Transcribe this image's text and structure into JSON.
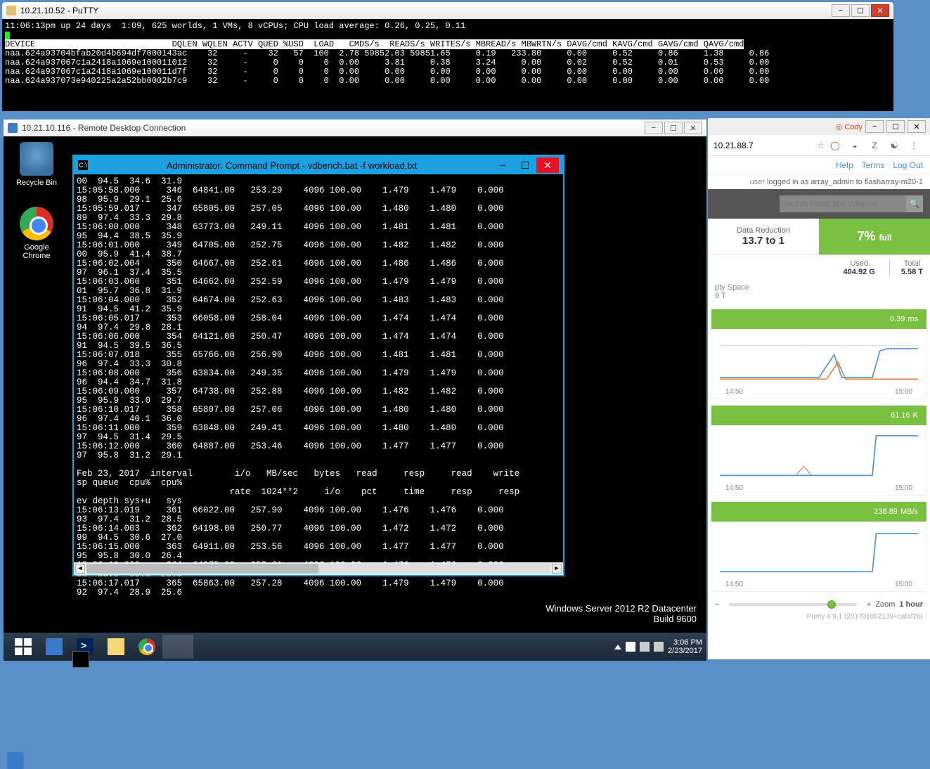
{
  "putty": {
    "title": "10.21.10.52 - PuTTY",
    "uptime_line": "11:06:13pm up 24 days  1:09, 625 worlds, 1 VMs, 8 vCPUs; CPU load average: 0.26, 0.25, 0.11",
    "header": "DEVICE                           DQLEN WQLEN ACTV QUED %USD  LOAD   CMDS/s  READS/s WRITES/s MBREAD/s MBWRTN/s DAVG/cmd KAVG/cmd GAVG/cmd QAVG/cmd",
    "rows": [
      "naa.624a93704bfab20d4b694df7000143ac    32     -    32   57  100  2.78 59852.03 59851.65     0.19   233.80     0.00     0.52     0.86     1.38     0.86",
      "naa.624a937067c1a2418a1069e100011012    32     -     0    0    0  0.00     3.81     0.38     3.24     0.00     0.02     0.52     0.01     0.53     0.00",
      "naa.624a937067c1a2418a1069e100011d7f    32     -     0    0    0  0.00     0.00     0.00     0.00     0.00     0.00     0.00     0.00     0.00     0.00",
      "naa.624a937073e940225a2a52bb0002b7c9    32     -     0    0    0  0.00     0.00     0.00     0.00     0.00     0.00     0.00     0.00     0.00     0.00"
    ]
  },
  "rdp": {
    "title": "10.21.10.116 - Remote Desktop Connection",
    "icons": {
      "recycle": "Recycle Bin",
      "chrome": "Google Chrome"
    },
    "cmd_title": "Administrator: Command Prompt - vdbench.bat  -f workload.txt",
    "cmd_body": "00  94.5  34.6  31.9\n15:05:58.000     346  64841.00   253.29    4096 100.00    1.479    1.479    0.000\n98  95.9  29.1  25.6\n15:05:59.017     347  65805.00   257.05    4096 100.00    1.480    1.480    0.000\n89  97.4  33.3  29.8\n15:06:00.000     348  63773.00   249.11    4096 100.00    1.481    1.481    0.000\n95  94.4  38.5  35.9\n15:06:01.000     349  64705.00   252.75    4096 100.00    1.482    1.482    0.000\n00  95.9  41.4  38.7\n15:06:02.004     350  64667.00   252.61    4096 100.00    1.486    1.486    0.000\n97  96.1  37.4  35.5\n15:06:03.000     351  64662.00   252.59    4096 100.00    1.479    1.479    0.000\n01  95.7  36.8  31.9\n15:06:04.000     352  64674.00   252.63    4096 100.00    1.483    1.483    0.000\n91  94.5  41.2  35.9\n15:06:05.017     353  66058.00   258.04    4096 100.00    1.474    1.474    0.000\n94  97.4  29.8  28.1\n15:06:06.000     354  64121.00   250.47    4096 100.00    1.474    1.474    0.000\n91  94.5  39.5  36.5\n15:06:07.018     355  65766.00   256.90    4096 100.00    1.481    1.481    0.000\n96  97.4  33.3  30.8\n15:06:08.000     356  63834.00   249.35    4096 100.00    1.479    1.479    0.000\n96  94.4  34.7  31.8\n15:06:09.000     357  64738.00   252.88    4096 100.00    1.482    1.482    0.000\n95  95.9  33.0  29.7\n15:06:10.017     358  65807.00   257.06    4096 100.00    1.480    1.480    0.000\n96  97.4  40.1  36.0\n15:06:11.000     359  63848.00   249.41    4096 100.00    1.480    1.480    0.000\n97  94.5  31.4  29.5\n15:06:12.000     360  64887.00   253.46    4096 100.00    1.477    1.477    0.000\n97  95.8  31.2  29.1\n\nFeb 23, 2017  interval        i/o   MB/sec   bytes   read     resp     read    write\nsp queue  cpu%  cpu%\n                             rate  1024**2     i/o    pct     time     resp     resp\nev depth sys+u   sys\n15:06:13.019     361  66022.00   257.90    4096 100.00    1.476    1.476    0.000\n93  97.4  31.2  28.5\n15:06:14.003     362  64198.00   250.77    4096 100.00    1.472    1.472    0.000\n99  94.5  30.6  27.0\n15:06:15.000     363  64911.00   253.56    4096 100.00    1.477    1.477    0.000\n95  95.8  30.0  26.4\n15:06:16.000     364  64975.00   253.81    4096 100.00    1.476    1.476    0.000\n93  95.9  30.3  28.9\n15:06:17.017     365  65863.00   257.28    4096 100.00    1.479    1.479    0.000\n92  97.4  28.9  25.6",
    "watermark_line1": "Windows Server 2012 R2 Datacenter",
    "watermark_line2": "Build 9600",
    "clock_time": "3:06 PM",
    "clock_date": "2/23/2017"
  },
  "browser": {
    "cody_label": "Cody",
    "url": "10.21.88.7",
    "help": "Help",
    "terms": "Terms",
    "logout": "Log Out",
    "login_prefix": "user ",
    "login_text": "logged in as array_admin to flasharray-m20-1",
    "search_placeholder": "Search Hosts and Volumes",
    "data_reduction_label": "Data Reduction",
    "data_reduction_value": "13.7 to 1",
    "full_pct": "7%",
    "full_suffix": "full",
    "used_label": "Used",
    "used_value": "404.92 G",
    "total_label": "Total",
    "total_value": "5.58 T",
    "empty_space_label": "pty Space",
    "empty_space_value": "9 T",
    "metric1": {
      "value": "0.39",
      "unit": "ms",
      "t0": "14:50",
      "t1": "15:00"
    },
    "metric2": {
      "value": "61.16",
      "unit": "K",
      "t0": "14:50",
      "t1": "15:00"
    },
    "metric3": {
      "value": "238.89",
      "unit": "MB/s",
      "t0": "14:50",
      "t1": "15:00"
    },
    "zoom_label": "Zoom",
    "zoom_value": "1 hour",
    "purity": "Purity 4.9.1 (201701062139+cafaf26)"
  }
}
